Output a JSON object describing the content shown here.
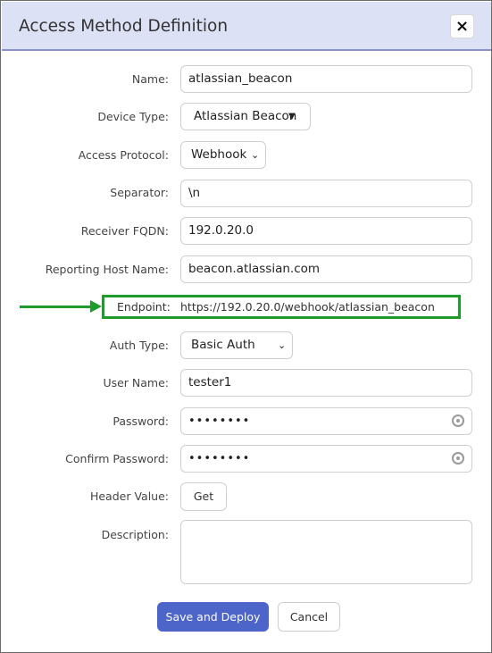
{
  "dialog": {
    "title": "Access Method Definition",
    "close_label": "×"
  },
  "form": {
    "name": {
      "label": "Name:",
      "value": "atlassian_beacon"
    },
    "device_type": {
      "label": "Device Type:",
      "value": "Atlassian Beacon"
    },
    "access_protocol": {
      "label": "Access Protocol:",
      "value": "Webhook"
    },
    "separator": {
      "label": "Separator:",
      "value": "\\n"
    },
    "receiver_fqdn": {
      "label": "Receiver FQDN:",
      "value": "192.0.20.0"
    },
    "reporting_host": {
      "label": "Reporting Host Name:",
      "value": "beacon.atlassian.com"
    },
    "endpoint": {
      "label": "Endpoint:",
      "value": "https://192.0.20.0/webhook/atlassian_beacon"
    },
    "auth_type": {
      "label": "Auth Type:",
      "value": "Basic Auth"
    },
    "user_name": {
      "label": "User Name:",
      "value": "tester1"
    },
    "password": {
      "label": "Password:",
      "value": "••••••••"
    },
    "confirm_password": {
      "label": "Confirm Password:",
      "value": "••••••••"
    },
    "header_value": {
      "label": "Header Value:",
      "button": "Get"
    },
    "description": {
      "label": "Description:",
      "value": ""
    }
  },
  "actions": {
    "save_label": "Save and Deploy",
    "cancel_label": "Cancel"
  },
  "colors": {
    "titlebar_bg": "#dde1f5",
    "primary": "#4d64c9",
    "highlight": "#1f9a2d"
  },
  "icons": {
    "close": "close-icon",
    "dropdown": "caret-down-icon",
    "password_reveal": "eye-icon",
    "annotation": "arrow-right-icon"
  }
}
